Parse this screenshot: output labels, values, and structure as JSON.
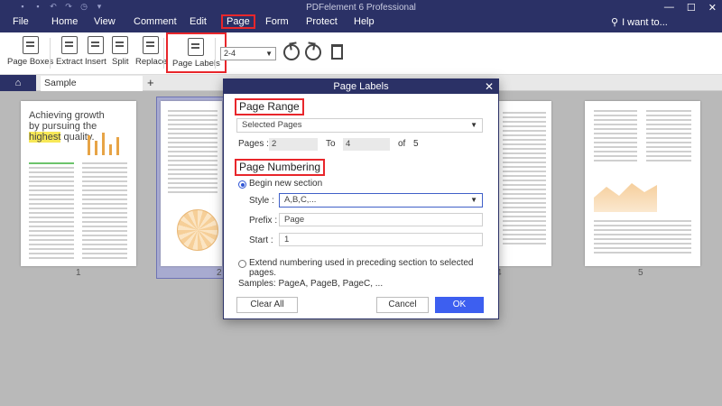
{
  "window": {
    "title": "PDFelement 6 Professional",
    "controls": [
      "—",
      "☐",
      "✕"
    ]
  },
  "menu": {
    "items": [
      "File",
      "Home",
      "View",
      "Comment",
      "Edit",
      "Page",
      "Form",
      "Protect",
      "Help"
    ],
    "active": "Page",
    "search_label": "I want to..."
  },
  "ribbon": {
    "page_boxes": "Page Boxes",
    "extract": "Extract",
    "insert": "Insert",
    "split": "Split",
    "replace": "Replace",
    "page_labels": "Page Labels",
    "page_range_value": "2-4"
  },
  "tabs": {
    "doc_tab": "Sample Documen...nded",
    "close": "✕",
    "add": "+"
  },
  "page_numbers": [
    "1",
    "2",
    "4",
    "5"
  ],
  "thumb1": {
    "line1": "Achieving growth",
    "line2": "by pursuing the",
    "highlight": "highest",
    "line3": " quality."
  },
  "dialog": {
    "title": "Page Labels",
    "close": "✕",
    "page_range_title": "Page Range",
    "range_select": "Selected Pages",
    "pages_label": "Pages :",
    "pages_from": "2",
    "to_label": "To",
    "pages_to": "4",
    "of_label": "of",
    "total_pages": "5",
    "numbering_title": "Page Numbering",
    "begin_new_section": "Begin new section",
    "style_label": "Style :",
    "style_value": "A,B,C,...",
    "prefix_label": "Prefix :",
    "prefix_value": "Page",
    "start_label": "Start :",
    "start_value": "1",
    "extend_label": "Extend numbering used in preceding section to selected pages.",
    "samples": "Samples: PageA, PageB, PageC, ...",
    "clear_all": "Clear All",
    "cancel": "Cancel",
    "ok": "OK"
  },
  "colors": {
    "titlebar": "#2b3166",
    "highlight_border": "#e8262b",
    "primary_button": "#3d5ff0"
  }
}
